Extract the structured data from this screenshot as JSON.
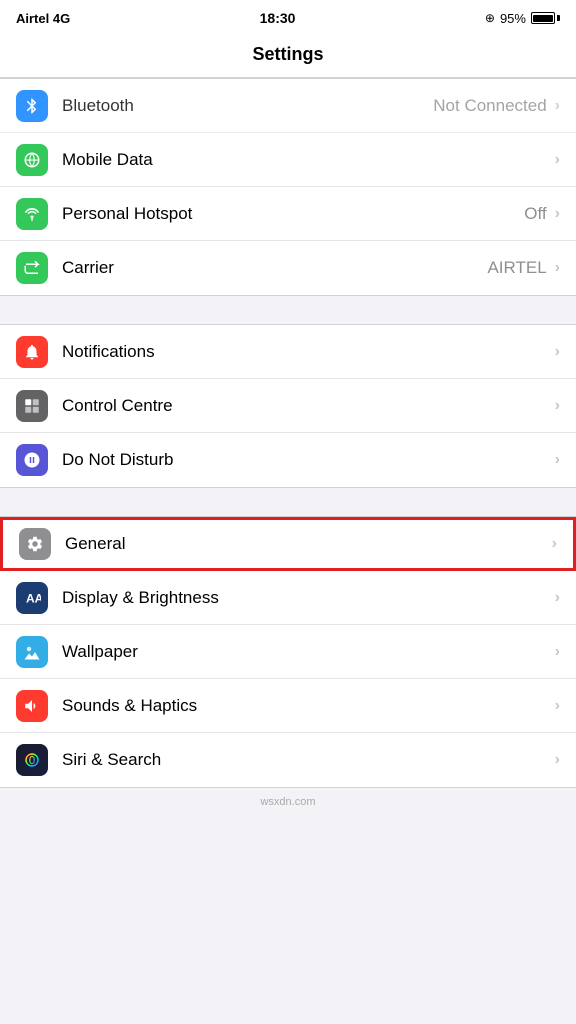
{
  "statusBar": {
    "carrier": "Airtel",
    "network": "4G",
    "time": "18:30",
    "battery": "95%",
    "batteryPercent": 95
  },
  "navBar": {
    "title": "Settings"
  },
  "sections": [
    {
      "id": "connectivity",
      "rows": [
        {
          "id": "bluetooth",
          "iconColor": "icon-blue",
          "icon": "bluetooth",
          "label": "Bluetooth",
          "value": "Not Connected",
          "hasChevron": true,
          "partial": true
        },
        {
          "id": "mobile-data",
          "iconColor": "icon-green",
          "icon": "mobile-data",
          "label": "Mobile Data",
          "value": "",
          "hasChevron": true
        },
        {
          "id": "personal-hotspot",
          "iconColor": "icon-teal",
          "icon": "hotspot",
          "label": "Personal Hotspot",
          "value": "Off",
          "hasChevron": true
        },
        {
          "id": "carrier",
          "iconColor": "icon-green",
          "icon": "carrier",
          "label": "Carrier",
          "value": "AIRTEL",
          "hasChevron": true
        }
      ]
    },
    {
      "id": "notifications",
      "rows": [
        {
          "id": "notifications",
          "iconColor": "icon-notification",
          "icon": "notifications",
          "label": "Notifications",
          "value": "",
          "hasChevron": true
        },
        {
          "id": "control-centre",
          "iconColor": "icon-control",
          "icon": "control-centre",
          "label": "Control Centre",
          "value": "",
          "hasChevron": true
        },
        {
          "id": "do-not-disturb",
          "iconColor": "icon-dnd",
          "icon": "do-not-disturb",
          "label": "Do Not Disturb",
          "value": "",
          "hasChevron": true
        }
      ]
    },
    {
      "id": "general-section",
      "rows": [
        {
          "id": "general",
          "iconColor": "icon-gray",
          "icon": "general",
          "label": "General",
          "value": "",
          "hasChevron": true,
          "highlighted": true
        },
        {
          "id": "display-brightness",
          "iconColor": "icon-dark-blue",
          "icon": "display",
          "label": "Display & Brightness",
          "value": "",
          "hasChevron": true
        },
        {
          "id": "wallpaper",
          "iconColor": "icon-wallpaper",
          "icon": "wallpaper",
          "label": "Wallpaper",
          "value": "",
          "hasChevron": true
        },
        {
          "id": "sounds-haptics",
          "iconColor": "icon-red",
          "icon": "sounds",
          "label": "Sounds & Haptics",
          "value": "",
          "hasChevron": true
        },
        {
          "id": "siri-search",
          "iconColor": "icon-siri",
          "icon": "siri",
          "label": "Siri & Search",
          "value": "",
          "hasChevron": true
        }
      ]
    }
  ]
}
